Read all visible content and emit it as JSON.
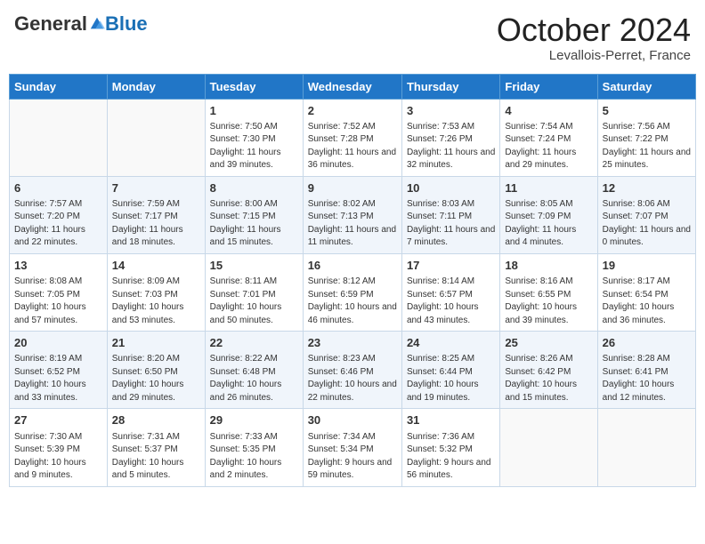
{
  "header": {
    "logo_general": "General",
    "logo_blue": "Blue",
    "month": "October 2024",
    "location": "Levallois-Perret, France"
  },
  "days_of_week": [
    "Sunday",
    "Monday",
    "Tuesday",
    "Wednesday",
    "Thursday",
    "Friday",
    "Saturday"
  ],
  "weeks": [
    [
      {
        "day": "",
        "info": ""
      },
      {
        "day": "",
        "info": ""
      },
      {
        "day": "1",
        "info": "Sunrise: 7:50 AM\nSunset: 7:30 PM\nDaylight: 11 hours and 39 minutes."
      },
      {
        "day": "2",
        "info": "Sunrise: 7:52 AM\nSunset: 7:28 PM\nDaylight: 11 hours and 36 minutes."
      },
      {
        "day": "3",
        "info": "Sunrise: 7:53 AM\nSunset: 7:26 PM\nDaylight: 11 hours and 32 minutes."
      },
      {
        "day": "4",
        "info": "Sunrise: 7:54 AM\nSunset: 7:24 PM\nDaylight: 11 hours and 29 minutes."
      },
      {
        "day": "5",
        "info": "Sunrise: 7:56 AM\nSunset: 7:22 PM\nDaylight: 11 hours and 25 minutes."
      }
    ],
    [
      {
        "day": "6",
        "info": "Sunrise: 7:57 AM\nSunset: 7:20 PM\nDaylight: 11 hours and 22 minutes."
      },
      {
        "day": "7",
        "info": "Sunrise: 7:59 AM\nSunset: 7:17 PM\nDaylight: 11 hours and 18 minutes."
      },
      {
        "day": "8",
        "info": "Sunrise: 8:00 AM\nSunset: 7:15 PM\nDaylight: 11 hours and 15 minutes."
      },
      {
        "day": "9",
        "info": "Sunrise: 8:02 AM\nSunset: 7:13 PM\nDaylight: 11 hours and 11 minutes."
      },
      {
        "day": "10",
        "info": "Sunrise: 8:03 AM\nSunset: 7:11 PM\nDaylight: 11 hours and 7 minutes."
      },
      {
        "day": "11",
        "info": "Sunrise: 8:05 AM\nSunset: 7:09 PM\nDaylight: 11 hours and 4 minutes."
      },
      {
        "day": "12",
        "info": "Sunrise: 8:06 AM\nSunset: 7:07 PM\nDaylight: 11 hours and 0 minutes."
      }
    ],
    [
      {
        "day": "13",
        "info": "Sunrise: 8:08 AM\nSunset: 7:05 PM\nDaylight: 10 hours and 57 minutes."
      },
      {
        "day": "14",
        "info": "Sunrise: 8:09 AM\nSunset: 7:03 PM\nDaylight: 10 hours and 53 minutes."
      },
      {
        "day": "15",
        "info": "Sunrise: 8:11 AM\nSunset: 7:01 PM\nDaylight: 10 hours and 50 minutes."
      },
      {
        "day": "16",
        "info": "Sunrise: 8:12 AM\nSunset: 6:59 PM\nDaylight: 10 hours and 46 minutes."
      },
      {
        "day": "17",
        "info": "Sunrise: 8:14 AM\nSunset: 6:57 PM\nDaylight: 10 hours and 43 minutes."
      },
      {
        "day": "18",
        "info": "Sunrise: 8:16 AM\nSunset: 6:55 PM\nDaylight: 10 hours and 39 minutes."
      },
      {
        "day": "19",
        "info": "Sunrise: 8:17 AM\nSunset: 6:54 PM\nDaylight: 10 hours and 36 minutes."
      }
    ],
    [
      {
        "day": "20",
        "info": "Sunrise: 8:19 AM\nSunset: 6:52 PM\nDaylight: 10 hours and 33 minutes."
      },
      {
        "day": "21",
        "info": "Sunrise: 8:20 AM\nSunset: 6:50 PM\nDaylight: 10 hours and 29 minutes."
      },
      {
        "day": "22",
        "info": "Sunrise: 8:22 AM\nSunset: 6:48 PM\nDaylight: 10 hours and 26 minutes."
      },
      {
        "day": "23",
        "info": "Sunrise: 8:23 AM\nSunset: 6:46 PM\nDaylight: 10 hours and 22 minutes."
      },
      {
        "day": "24",
        "info": "Sunrise: 8:25 AM\nSunset: 6:44 PM\nDaylight: 10 hours and 19 minutes."
      },
      {
        "day": "25",
        "info": "Sunrise: 8:26 AM\nSunset: 6:42 PM\nDaylight: 10 hours and 15 minutes."
      },
      {
        "day": "26",
        "info": "Sunrise: 8:28 AM\nSunset: 6:41 PM\nDaylight: 10 hours and 12 minutes."
      }
    ],
    [
      {
        "day": "27",
        "info": "Sunrise: 7:30 AM\nSunset: 5:39 PM\nDaylight: 10 hours and 9 minutes."
      },
      {
        "day": "28",
        "info": "Sunrise: 7:31 AM\nSunset: 5:37 PM\nDaylight: 10 hours and 5 minutes."
      },
      {
        "day": "29",
        "info": "Sunrise: 7:33 AM\nSunset: 5:35 PM\nDaylight: 10 hours and 2 minutes."
      },
      {
        "day": "30",
        "info": "Sunrise: 7:34 AM\nSunset: 5:34 PM\nDaylight: 9 hours and 59 minutes."
      },
      {
        "day": "31",
        "info": "Sunrise: 7:36 AM\nSunset: 5:32 PM\nDaylight: 9 hours and 56 minutes."
      },
      {
        "day": "",
        "info": ""
      },
      {
        "day": "",
        "info": ""
      }
    ]
  ]
}
